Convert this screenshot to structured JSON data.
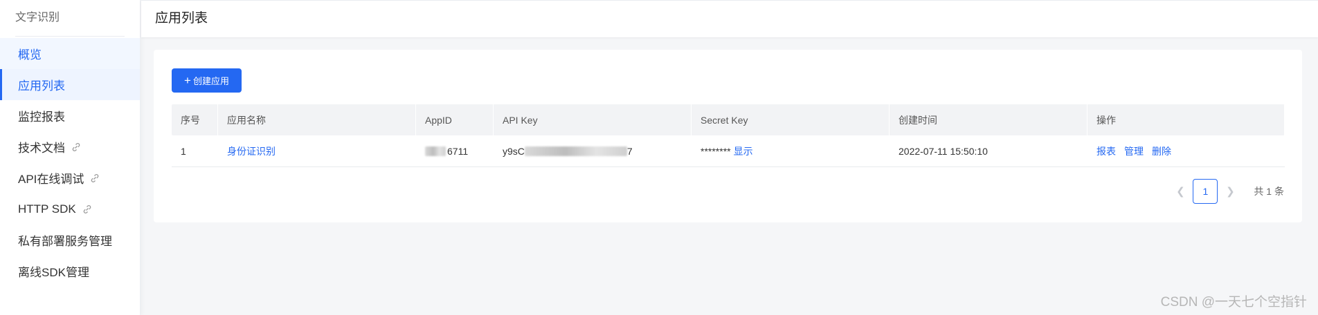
{
  "sidebar": {
    "title": "文字识别",
    "items": [
      {
        "label": "概览"
      },
      {
        "label": "应用列表"
      },
      {
        "label": "监控报表"
      },
      {
        "label": "技术文档"
      },
      {
        "label": "API在线调试"
      },
      {
        "label": "HTTP SDK"
      },
      {
        "label": "私有部署服务管理"
      },
      {
        "label": "离线SDK管理"
      }
    ]
  },
  "header": {
    "title": "应用列表"
  },
  "toolbar": {
    "create_label": "创建应用",
    "create_icon": "plus-icon"
  },
  "table": {
    "columns": [
      "序号",
      "应用名称",
      "AppID",
      "API Key",
      "Secret Key",
      "创建时间",
      "操作"
    ],
    "rows": [
      {
        "index": "1",
        "name": "身份证识别",
        "appid_visible": "6711",
        "apikey_visible_prefix": "y9sC",
        "apikey_visible_suffix": "7",
        "secret_masked": "********",
        "secret_show": "显示",
        "created": "2022-07-11 15:50:10",
        "actions": [
          "报表",
          "管理",
          "删除"
        ]
      }
    ]
  },
  "pagination": {
    "current": "1",
    "total": "共 1 条"
  },
  "watermark": "CSDN @一天七个空指针",
  "colors": {
    "accent": "#2468f2"
  }
}
